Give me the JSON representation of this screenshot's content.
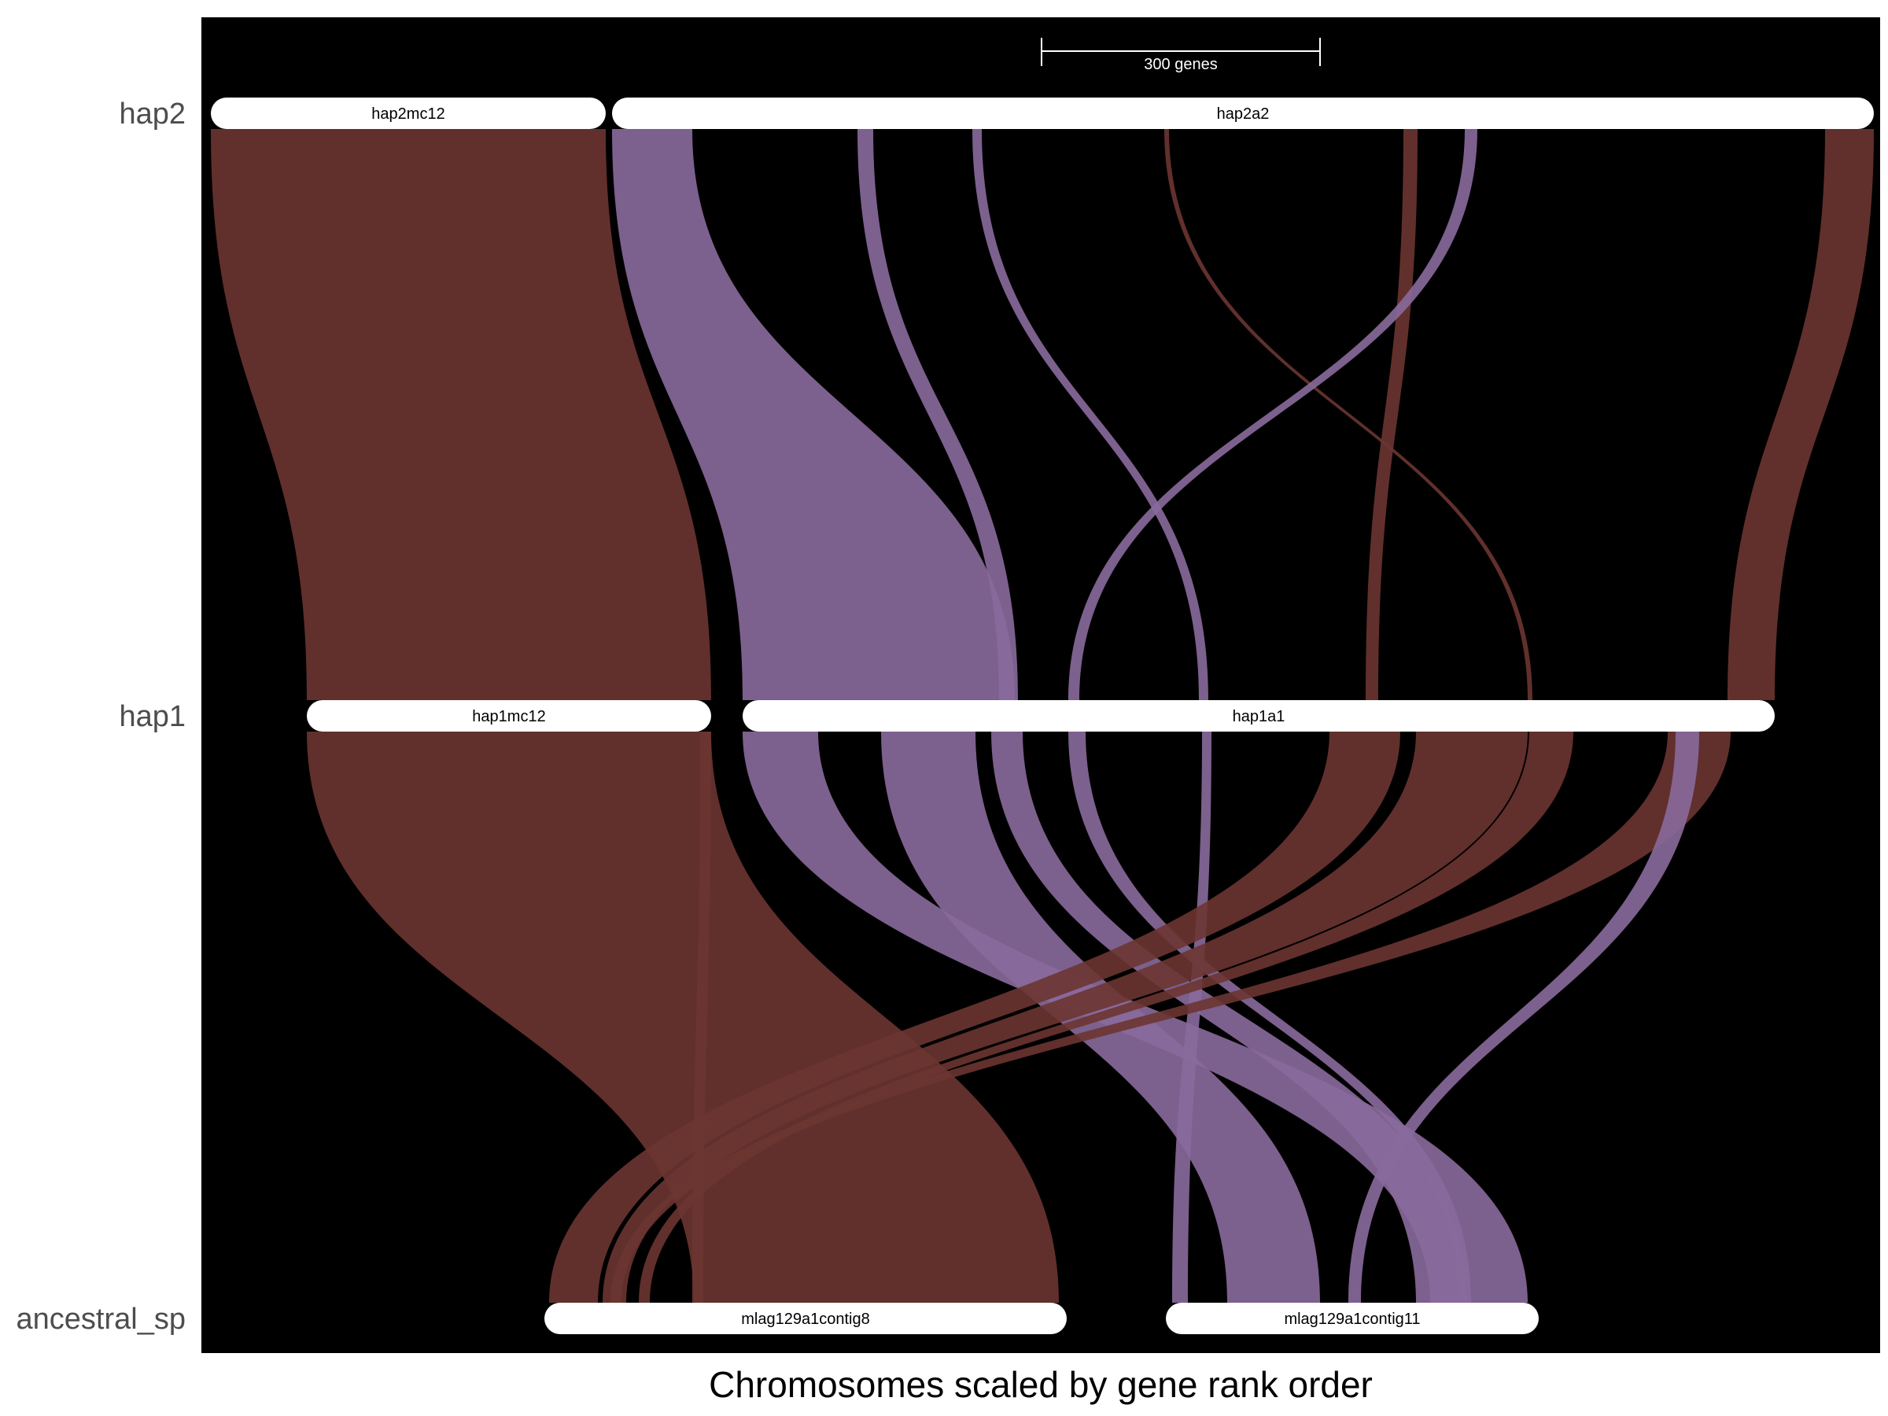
{
  "tracks": [
    {
      "key": "hap2",
      "label": "hap2"
    },
    {
      "key": "hap1",
      "label": "hap1"
    },
    {
      "key": "ancestral_sp",
      "label": "ancestral_sp"
    }
  ],
  "chromosomes": {
    "hap2mc12": "hap2mc12",
    "hap2a2": "hap2a2",
    "hap1mc12": "hap1mc12",
    "hap1a1": "hap1a1",
    "mlag129a1contig8": "mlag129a1contig8",
    "mlag129a1contig11": "mlag129a1contig11"
  },
  "scale_bar": {
    "label": "300 genes",
    "genes": 300
  },
  "x_axis_title": "Chromosomes scaled by gene rank order",
  "colors": {
    "background": "#000000",
    "chromosome": "#ffffff",
    "ribbon_brown": "#6b3531",
    "ribbon_purple": "#8a6a9c"
  }
}
